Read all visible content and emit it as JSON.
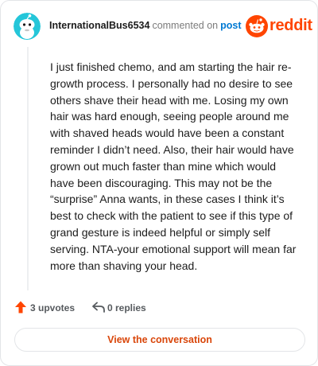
{
  "comment": {
    "username": "InternationalBus6534",
    "action_text": "commented on",
    "post_link": "post",
    "body": "I just finished chemo, and am starting the hair re-growth process. I personally had no desire to see others shave their head with me. Losing my own hair was hard enough, seeing people around me with shaved heads would have been a constant reminder I didn’t need. Also, their hair would have grown out much faster than mine which would have been discouraging. This may not be the “surprise” Anna wants, in these cases I think it’s best to check with the patient to see if this type of grand gesture is indeed helpful or simply self serving. NTA-your emotional support will mean far more than shaving your head."
  },
  "brand": {
    "name": "reddit",
    "color": "#ff4500"
  },
  "footer": {
    "upvotes": "3 upvotes",
    "replies": "0 replies",
    "cta": "View the conversation"
  },
  "icons": {
    "avatar": "snoo-avatar-icon",
    "logo": "reddit-logo-icon",
    "upvote": "upvote-arrow-icon",
    "reply": "reply-arrow-icon"
  }
}
